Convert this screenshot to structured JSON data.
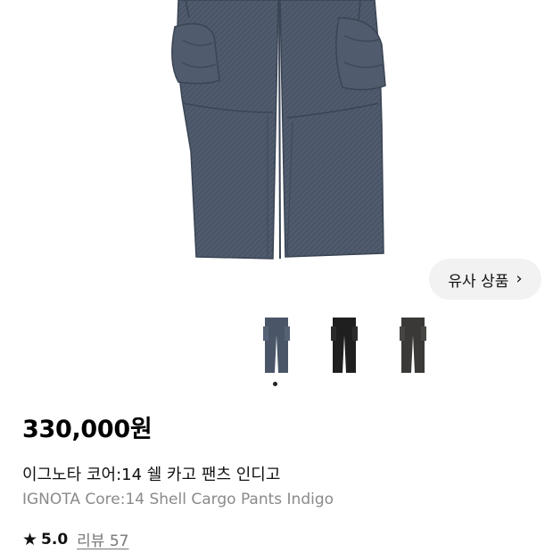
{
  "hero": {
    "image": "cargo-pants-indigo-photo"
  },
  "similar_button": {
    "label": "유사 상품",
    "icon": "chevron-right-icon"
  },
  "thumbnails": [
    {
      "name": "indigo",
      "color": "#4a5668"
    },
    {
      "name": "black",
      "color": "#1f1f1f"
    },
    {
      "name": "charcoal",
      "color": "#3a3937"
    }
  ],
  "carousel": {
    "active_index": 0
  },
  "product": {
    "price": "330,000원",
    "title_ko": "이그노타 코어:14 쉘 카고 팬츠 인디고",
    "title_en": "IGNOTA Core:14 Shell Cargo Pants Indigo"
  },
  "rating": {
    "icon": "star-icon",
    "score": "5.0",
    "reviews_label": "리뷰 57"
  },
  "colors": {
    "denim": "#4a5668",
    "denim_dark": "#3b4656"
  }
}
